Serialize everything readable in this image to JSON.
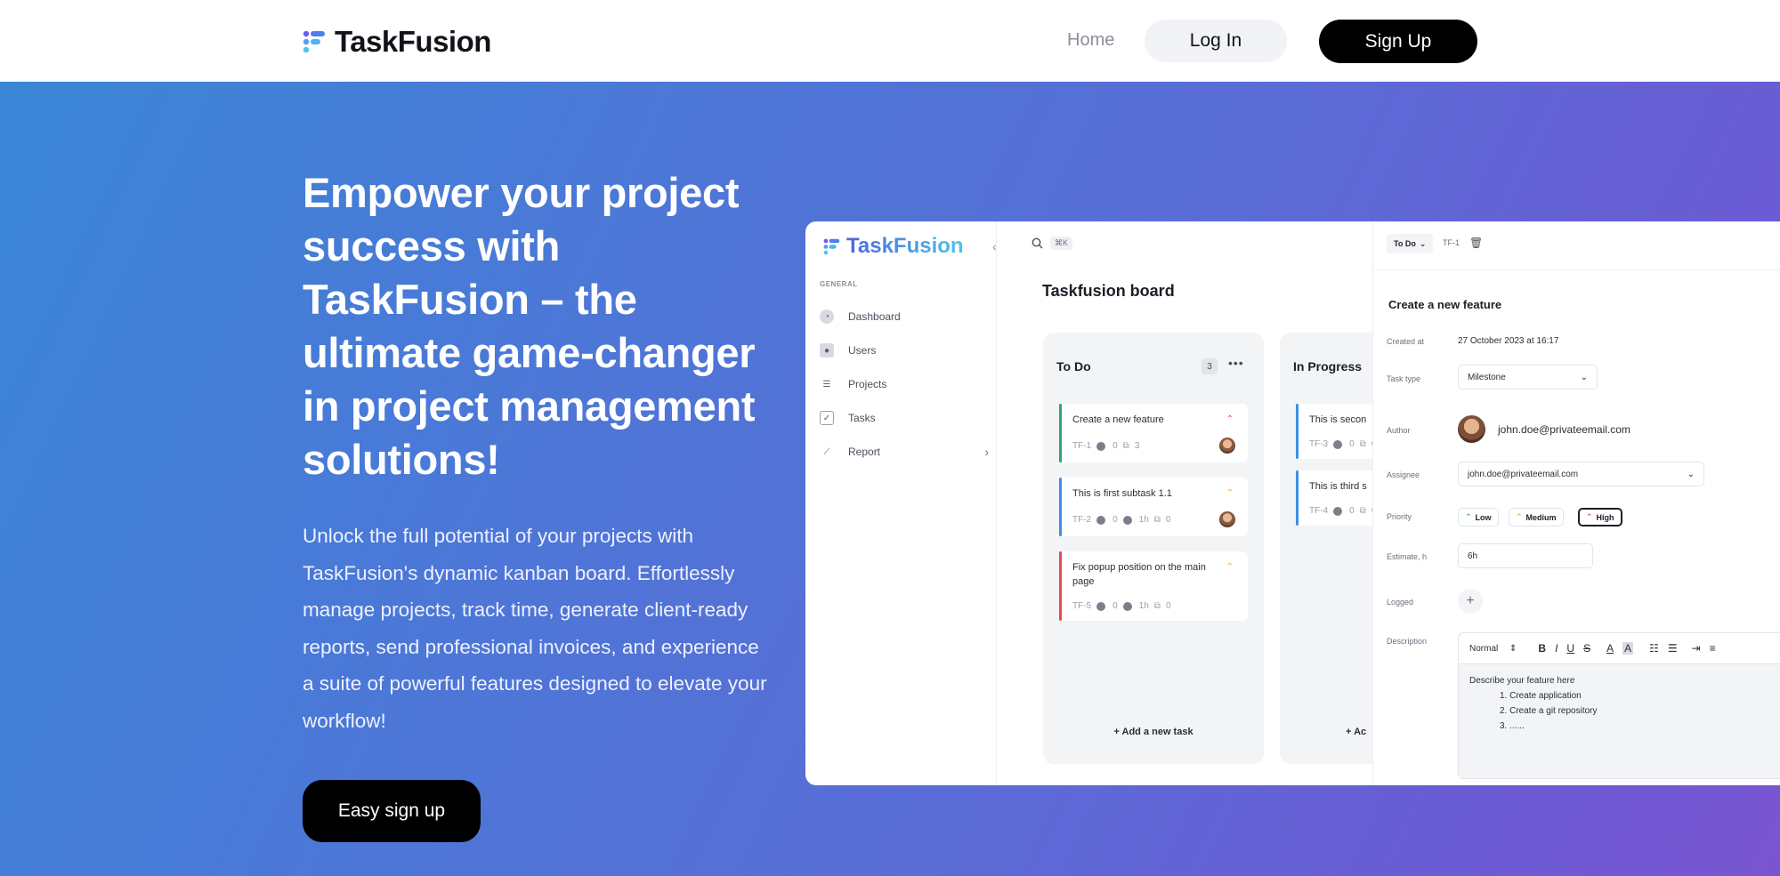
{
  "nav": {
    "brand": "TaskFusion",
    "home": "Home",
    "login": "Log In",
    "signup": "Sign Up"
  },
  "hero": {
    "title": "Empower your project success with TaskFusion – the ultimate game-changer in project management solutions!",
    "description": "Unlock the full potential of your projects with TaskFusion's dynamic kanban board. Effortlessly manage projects, track time, generate client-ready reports, send professional invoices, and experience a suite of powerful features designed to elevate your workflow!",
    "cta": "Easy sign up"
  },
  "preview": {
    "logo": "TaskFusion",
    "section_label": "GENERAL",
    "menu": [
      {
        "label": "Dashboard",
        "icon": "dashboard-icon"
      },
      {
        "label": "Users",
        "icon": "users-icon"
      },
      {
        "label": "Projects",
        "icon": "projects-icon"
      },
      {
        "label": "Tasks",
        "icon": "tasks-icon"
      },
      {
        "label": "Report",
        "icon": "report-icon"
      }
    ],
    "search_shortcut": "⌘K",
    "board_title": "Taskfusion board",
    "columns": [
      {
        "title": "To Do",
        "count": "3",
        "add_label": "Add a new task",
        "cards": [
          {
            "title": "Create a new feature",
            "id": "TF-1",
            "comments": "0",
            "time": "",
            "subtasks": "3",
            "priority": "High"
          },
          {
            "title": "This is first subtask 1.1",
            "id": "TF-2",
            "comments": "0",
            "time": "1h",
            "subtasks": "0",
            "priority": "Medium"
          },
          {
            "title": "Fix popup position on the main page",
            "id": "TF-5",
            "comments": "0",
            "time": "1h",
            "subtasks": "0",
            "priority": "Medium"
          }
        ]
      },
      {
        "title": "In Progress",
        "add_label": "Ac",
        "cards": [
          {
            "title": "This is secon",
            "id": "TF-3",
            "comments": "0",
            "subtasks": "0"
          },
          {
            "title": "This is third s",
            "id": "TF-4",
            "comments": "0",
            "subtasks": "0"
          }
        ]
      }
    ],
    "detail": {
      "status": "To Do",
      "id": "TF-1",
      "title": "Create a new feature",
      "created_label": "Created at",
      "created_value": "27 October 2023 at 16:17",
      "type_label": "Task type",
      "type_value": "Milestone",
      "author_label": "Author",
      "author_value": "john.doe@privateemail.com",
      "assignee_label": "Assignee",
      "assignee_value": "john.doe@privateemail.com",
      "priority_label": "Priority",
      "priority_options": [
        "Low",
        "Medium",
        "High"
      ],
      "priority_selected": "High",
      "estimate_label": "Estimate, h",
      "estimate_value": "6h",
      "logged_label": "Logged",
      "description_label": "Description",
      "editor_style": "Normal",
      "description_intro": "Describe your feature here",
      "description_items": [
        "Create application",
        "Create a git repository",
        "......"
      ]
    }
  },
  "colors": {
    "hero_gradient_start": "#3a86d6",
    "hero_gradient_end": "#7a55d2",
    "button_black": "#000000",
    "priority_high": "#e5484d",
    "priority_medium": "#f5a524",
    "priority_low": "#30a46c"
  }
}
